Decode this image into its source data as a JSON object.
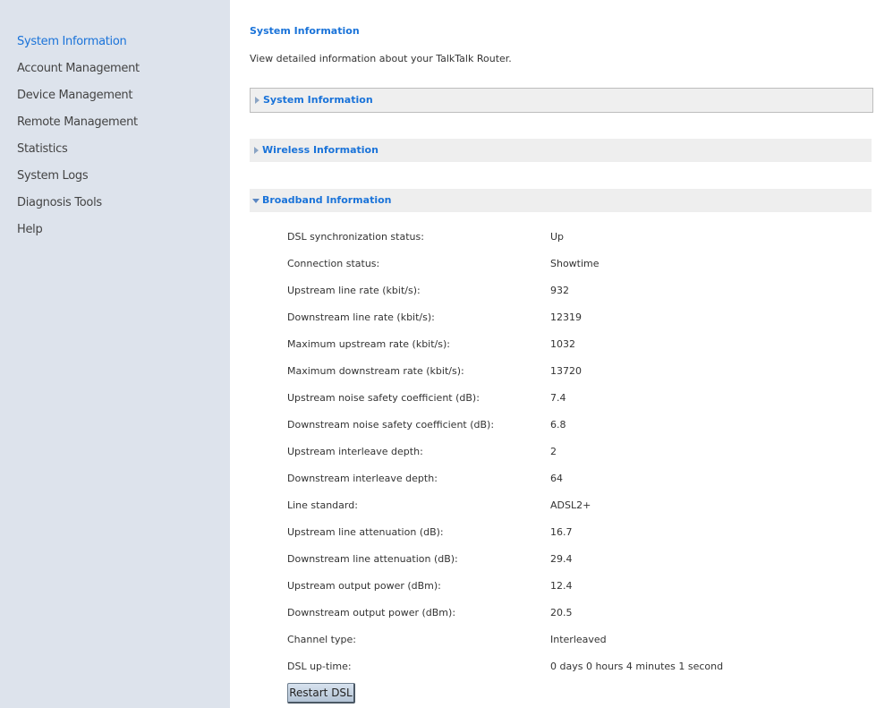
{
  "sidebar": {
    "items": [
      {
        "label": "System Information",
        "active": true
      },
      {
        "label": "Account Management"
      },
      {
        "label": "Device Management"
      },
      {
        "label": "Remote Management"
      },
      {
        "label": "Statistics"
      },
      {
        "label": "System Logs"
      },
      {
        "label": "Diagnosis Tools"
      },
      {
        "label": "Help"
      }
    ]
  },
  "main": {
    "title": "System Information",
    "description": "View detailed information about your TalkTalk Router.",
    "sections": [
      {
        "label": "System Information",
        "expanded": false
      },
      {
        "label": "Wireless Information",
        "expanded": false
      },
      {
        "label": "Broadband Information",
        "expanded": true
      }
    ],
    "broadband": {
      "rows": [
        {
          "key": "DSL synchronization status:",
          "value": "Up"
        },
        {
          "key": "Connection status:",
          "value": "Showtime"
        },
        {
          "key": "Upstream line rate (kbit/s):",
          "value": "932"
        },
        {
          "key": "Downstream line rate (kbit/s):",
          "value": "12319"
        },
        {
          "key": "Maximum upstream rate (kbit/s):",
          "value": "1032"
        },
        {
          "key": "Maximum downstream rate (kbit/s):",
          "value": "13720"
        },
        {
          "key": "Upstream noise safety coefficient (dB):",
          "value": "7.4"
        },
        {
          "key": "Downstream noise safety coefficient (dB):",
          "value": "6.8"
        },
        {
          "key": "Upstream interleave depth:",
          "value": "2"
        },
        {
          "key": "Downstream interleave depth:",
          "value": "64"
        },
        {
          "key": "Line standard:",
          "value": "ADSL2+"
        },
        {
          "key": "Upstream line attenuation (dB):",
          "value": "16.7"
        },
        {
          "key": "Downstream line attenuation (dB):",
          "value": "29.4"
        },
        {
          "key": "Upstream output power (dBm):",
          "value": "12.4"
        },
        {
          "key": "Downstream output power (dBm):",
          "value": "20.5"
        },
        {
          "key": "Channel type:",
          "value": "Interleaved"
        },
        {
          "key": "DSL up-time:",
          "value": "0 days 0 hours 4 minutes 1 second"
        }
      ],
      "restart_label": "Restart DSL"
    }
  },
  "colors": {
    "accent": "#1a73d9",
    "sidebar_bg": "#dde3ec",
    "section_bg": "#eeeeee"
  }
}
